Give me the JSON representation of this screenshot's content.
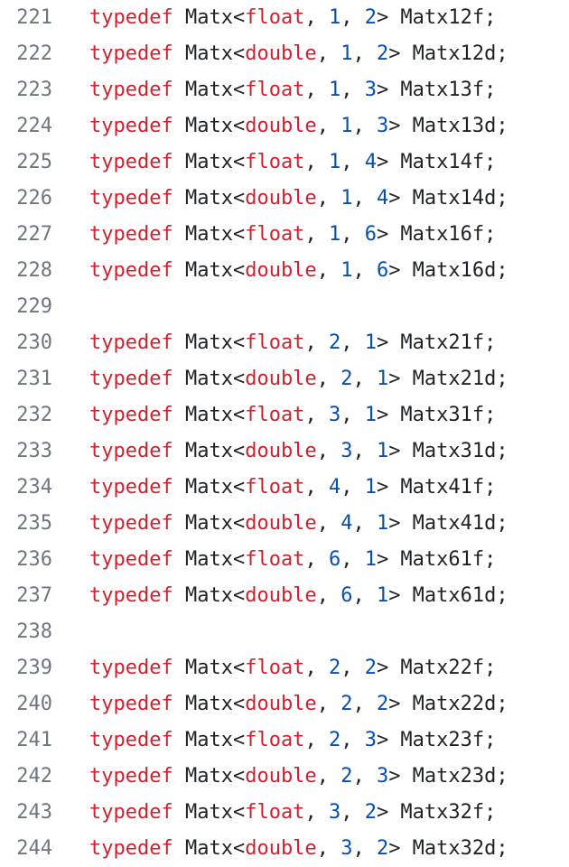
{
  "colors": {
    "background": "#ffffff",
    "line_number": "#6e7781",
    "keyword": "#cf222e",
    "type": "#cf222e",
    "number": "#0550ae",
    "plain": "#1f2328"
  },
  "code": {
    "lines": [
      {
        "number": "221",
        "tokens": [
          {
            "text": "typedef",
            "kind": "keyword"
          },
          {
            "text": " Matx<",
            "kind": "plain"
          },
          {
            "text": "float",
            "kind": "type"
          },
          {
            "text": ", ",
            "kind": "plain"
          },
          {
            "text": "1",
            "kind": "number"
          },
          {
            "text": ", ",
            "kind": "plain"
          },
          {
            "text": "2",
            "kind": "number"
          },
          {
            "text": "> Matx12f;",
            "kind": "plain"
          }
        ]
      },
      {
        "number": "222",
        "tokens": [
          {
            "text": "typedef",
            "kind": "keyword"
          },
          {
            "text": " Matx<",
            "kind": "plain"
          },
          {
            "text": "double",
            "kind": "type"
          },
          {
            "text": ", ",
            "kind": "plain"
          },
          {
            "text": "1",
            "kind": "number"
          },
          {
            "text": ", ",
            "kind": "plain"
          },
          {
            "text": "2",
            "kind": "number"
          },
          {
            "text": "> Matx12d;",
            "kind": "plain"
          }
        ]
      },
      {
        "number": "223",
        "tokens": [
          {
            "text": "typedef",
            "kind": "keyword"
          },
          {
            "text": " Matx<",
            "kind": "plain"
          },
          {
            "text": "float",
            "kind": "type"
          },
          {
            "text": ", ",
            "kind": "plain"
          },
          {
            "text": "1",
            "kind": "number"
          },
          {
            "text": ", ",
            "kind": "plain"
          },
          {
            "text": "3",
            "kind": "number"
          },
          {
            "text": "> Matx13f;",
            "kind": "plain"
          }
        ]
      },
      {
        "number": "224",
        "tokens": [
          {
            "text": "typedef",
            "kind": "keyword"
          },
          {
            "text": " Matx<",
            "kind": "plain"
          },
          {
            "text": "double",
            "kind": "type"
          },
          {
            "text": ", ",
            "kind": "plain"
          },
          {
            "text": "1",
            "kind": "number"
          },
          {
            "text": ", ",
            "kind": "plain"
          },
          {
            "text": "3",
            "kind": "number"
          },
          {
            "text": "> Matx13d;",
            "kind": "plain"
          }
        ]
      },
      {
        "number": "225",
        "tokens": [
          {
            "text": "typedef",
            "kind": "keyword"
          },
          {
            "text": " Matx<",
            "kind": "plain"
          },
          {
            "text": "float",
            "kind": "type"
          },
          {
            "text": ", ",
            "kind": "plain"
          },
          {
            "text": "1",
            "kind": "number"
          },
          {
            "text": ", ",
            "kind": "plain"
          },
          {
            "text": "4",
            "kind": "number"
          },
          {
            "text": "> Matx14f;",
            "kind": "plain"
          }
        ]
      },
      {
        "number": "226",
        "tokens": [
          {
            "text": "typedef",
            "kind": "keyword"
          },
          {
            "text": " Matx<",
            "kind": "plain"
          },
          {
            "text": "double",
            "kind": "type"
          },
          {
            "text": ", ",
            "kind": "plain"
          },
          {
            "text": "1",
            "kind": "number"
          },
          {
            "text": ", ",
            "kind": "plain"
          },
          {
            "text": "4",
            "kind": "number"
          },
          {
            "text": "> Matx14d;",
            "kind": "plain"
          }
        ]
      },
      {
        "number": "227",
        "tokens": [
          {
            "text": "typedef",
            "kind": "keyword"
          },
          {
            "text": " Matx<",
            "kind": "plain"
          },
          {
            "text": "float",
            "kind": "type"
          },
          {
            "text": ", ",
            "kind": "plain"
          },
          {
            "text": "1",
            "kind": "number"
          },
          {
            "text": ", ",
            "kind": "plain"
          },
          {
            "text": "6",
            "kind": "number"
          },
          {
            "text": "> Matx16f;",
            "kind": "plain"
          }
        ]
      },
      {
        "number": "228",
        "tokens": [
          {
            "text": "typedef",
            "kind": "keyword"
          },
          {
            "text": " Matx<",
            "kind": "plain"
          },
          {
            "text": "double",
            "kind": "type"
          },
          {
            "text": ", ",
            "kind": "plain"
          },
          {
            "text": "1",
            "kind": "number"
          },
          {
            "text": ", ",
            "kind": "plain"
          },
          {
            "text": "6",
            "kind": "number"
          },
          {
            "text": "> Matx16d;",
            "kind": "plain"
          }
        ]
      },
      {
        "number": "229",
        "tokens": []
      },
      {
        "number": "230",
        "tokens": [
          {
            "text": "typedef",
            "kind": "keyword"
          },
          {
            "text": " Matx<",
            "kind": "plain"
          },
          {
            "text": "float",
            "kind": "type"
          },
          {
            "text": ", ",
            "kind": "plain"
          },
          {
            "text": "2",
            "kind": "number"
          },
          {
            "text": ", ",
            "kind": "plain"
          },
          {
            "text": "1",
            "kind": "number"
          },
          {
            "text": "> Matx21f;",
            "kind": "plain"
          }
        ]
      },
      {
        "number": "231",
        "tokens": [
          {
            "text": "typedef",
            "kind": "keyword"
          },
          {
            "text": " Matx<",
            "kind": "plain"
          },
          {
            "text": "double",
            "kind": "type"
          },
          {
            "text": ", ",
            "kind": "plain"
          },
          {
            "text": "2",
            "kind": "number"
          },
          {
            "text": ", ",
            "kind": "plain"
          },
          {
            "text": "1",
            "kind": "number"
          },
          {
            "text": "> Matx21d;",
            "kind": "plain"
          }
        ]
      },
      {
        "number": "232",
        "tokens": [
          {
            "text": "typedef",
            "kind": "keyword"
          },
          {
            "text": " Matx<",
            "kind": "plain"
          },
          {
            "text": "float",
            "kind": "type"
          },
          {
            "text": ", ",
            "kind": "plain"
          },
          {
            "text": "3",
            "kind": "number"
          },
          {
            "text": ", ",
            "kind": "plain"
          },
          {
            "text": "1",
            "kind": "number"
          },
          {
            "text": "> Matx31f;",
            "kind": "plain"
          }
        ]
      },
      {
        "number": "233",
        "tokens": [
          {
            "text": "typedef",
            "kind": "keyword"
          },
          {
            "text": " Matx<",
            "kind": "plain"
          },
          {
            "text": "double",
            "kind": "type"
          },
          {
            "text": ", ",
            "kind": "plain"
          },
          {
            "text": "3",
            "kind": "number"
          },
          {
            "text": ", ",
            "kind": "plain"
          },
          {
            "text": "1",
            "kind": "number"
          },
          {
            "text": "> Matx31d;",
            "kind": "plain"
          }
        ]
      },
      {
        "number": "234",
        "tokens": [
          {
            "text": "typedef",
            "kind": "keyword"
          },
          {
            "text": " Matx<",
            "kind": "plain"
          },
          {
            "text": "float",
            "kind": "type"
          },
          {
            "text": ", ",
            "kind": "plain"
          },
          {
            "text": "4",
            "kind": "number"
          },
          {
            "text": ", ",
            "kind": "plain"
          },
          {
            "text": "1",
            "kind": "number"
          },
          {
            "text": "> Matx41f;",
            "kind": "plain"
          }
        ]
      },
      {
        "number": "235",
        "tokens": [
          {
            "text": "typedef",
            "kind": "keyword"
          },
          {
            "text": " Matx<",
            "kind": "plain"
          },
          {
            "text": "double",
            "kind": "type"
          },
          {
            "text": ", ",
            "kind": "plain"
          },
          {
            "text": "4",
            "kind": "number"
          },
          {
            "text": ", ",
            "kind": "plain"
          },
          {
            "text": "1",
            "kind": "number"
          },
          {
            "text": "> Matx41d;",
            "kind": "plain"
          }
        ]
      },
      {
        "number": "236",
        "tokens": [
          {
            "text": "typedef",
            "kind": "keyword"
          },
          {
            "text": " Matx<",
            "kind": "plain"
          },
          {
            "text": "float",
            "kind": "type"
          },
          {
            "text": ", ",
            "kind": "plain"
          },
          {
            "text": "6",
            "kind": "number"
          },
          {
            "text": ", ",
            "kind": "plain"
          },
          {
            "text": "1",
            "kind": "number"
          },
          {
            "text": "> Matx61f;",
            "kind": "plain"
          }
        ]
      },
      {
        "number": "237",
        "tokens": [
          {
            "text": "typedef",
            "kind": "keyword"
          },
          {
            "text": " Matx<",
            "kind": "plain"
          },
          {
            "text": "double",
            "kind": "type"
          },
          {
            "text": ", ",
            "kind": "plain"
          },
          {
            "text": "6",
            "kind": "number"
          },
          {
            "text": ", ",
            "kind": "plain"
          },
          {
            "text": "1",
            "kind": "number"
          },
          {
            "text": "> Matx61d;",
            "kind": "plain"
          }
        ]
      },
      {
        "number": "238",
        "tokens": []
      },
      {
        "number": "239",
        "tokens": [
          {
            "text": "typedef",
            "kind": "keyword"
          },
          {
            "text": " Matx<",
            "kind": "plain"
          },
          {
            "text": "float",
            "kind": "type"
          },
          {
            "text": ", ",
            "kind": "plain"
          },
          {
            "text": "2",
            "kind": "number"
          },
          {
            "text": ", ",
            "kind": "plain"
          },
          {
            "text": "2",
            "kind": "number"
          },
          {
            "text": "> Matx22f;",
            "kind": "plain"
          }
        ]
      },
      {
        "number": "240",
        "tokens": [
          {
            "text": "typedef",
            "kind": "keyword"
          },
          {
            "text": " Matx<",
            "kind": "plain"
          },
          {
            "text": "double",
            "kind": "type"
          },
          {
            "text": ", ",
            "kind": "plain"
          },
          {
            "text": "2",
            "kind": "number"
          },
          {
            "text": ", ",
            "kind": "plain"
          },
          {
            "text": "2",
            "kind": "number"
          },
          {
            "text": "> Matx22d;",
            "kind": "plain"
          }
        ]
      },
      {
        "number": "241",
        "tokens": [
          {
            "text": "typedef",
            "kind": "keyword"
          },
          {
            "text": " Matx<",
            "kind": "plain"
          },
          {
            "text": "float",
            "kind": "type"
          },
          {
            "text": ", ",
            "kind": "plain"
          },
          {
            "text": "2",
            "kind": "number"
          },
          {
            "text": ", ",
            "kind": "plain"
          },
          {
            "text": "3",
            "kind": "number"
          },
          {
            "text": "> Matx23f;",
            "kind": "plain"
          }
        ]
      },
      {
        "number": "242",
        "tokens": [
          {
            "text": "typedef",
            "kind": "keyword"
          },
          {
            "text": " Matx<",
            "kind": "plain"
          },
          {
            "text": "double",
            "kind": "type"
          },
          {
            "text": ", ",
            "kind": "plain"
          },
          {
            "text": "2",
            "kind": "number"
          },
          {
            "text": ", ",
            "kind": "plain"
          },
          {
            "text": "3",
            "kind": "number"
          },
          {
            "text": "> Matx23d;",
            "kind": "plain"
          }
        ]
      },
      {
        "number": "243",
        "tokens": [
          {
            "text": "typedef",
            "kind": "keyword"
          },
          {
            "text": " Matx<",
            "kind": "plain"
          },
          {
            "text": "float",
            "kind": "type"
          },
          {
            "text": ", ",
            "kind": "plain"
          },
          {
            "text": "3",
            "kind": "number"
          },
          {
            "text": ", ",
            "kind": "plain"
          },
          {
            "text": "2",
            "kind": "number"
          },
          {
            "text": "> Matx32f;",
            "kind": "plain"
          }
        ]
      },
      {
        "number": "244",
        "tokens": [
          {
            "text": "typedef",
            "kind": "keyword"
          },
          {
            "text": " Matx<",
            "kind": "plain"
          },
          {
            "text": "double",
            "kind": "type"
          },
          {
            "text": ", ",
            "kind": "plain"
          },
          {
            "text": "3",
            "kind": "number"
          },
          {
            "text": ", ",
            "kind": "plain"
          },
          {
            "text": "2",
            "kind": "number"
          },
          {
            "text": "> Matx32d;",
            "kind": "plain"
          }
        ]
      }
    ]
  }
}
